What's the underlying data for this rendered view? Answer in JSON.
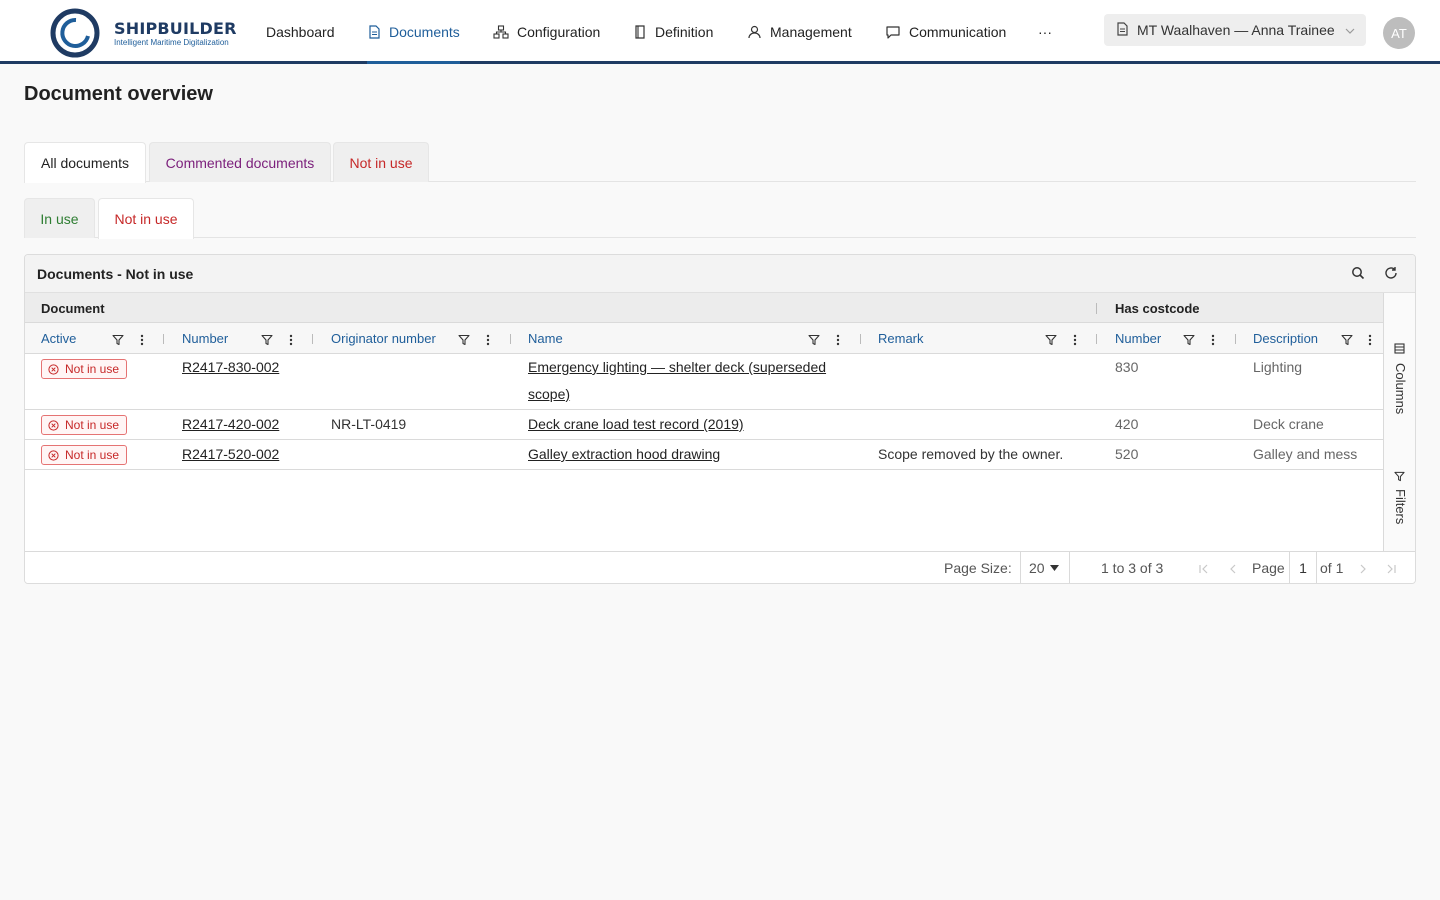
{
  "brand": {
    "name": "SHIPBUILDER",
    "tagline": "Intelligent Maritime Digitalization",
    "color": "#1f3b63"
  },
  "nav": {
    "items": [
      {
        "label": "Dashboard",
        "icon": "none"
      },
      {
        "label": "Documents",
        "icon": "document-icon",
        "active": true
      },
      {
        "label": "Configuration",
        "icon": "hierarchy-icon"
      },
      {
        "label": "Definition",
        "icon": "book-icon"
      },
      {
        "label": "Management",
        "icon": "user-icon"
      },
      {
        "label": "Communication",
        "icon": "chat-icon"
      }
    ],
    "more": "···"
  },
  "vessel": {
    "label": "MT Waalhaven — Anna Trainee"
  },
  "user": {
    "initials": "AT"
  },
  "page": {
    "title": "Document overview"
  },
  "tabs_primary": [
    {
      "label": "All documents",
      "color": "#222222",
      "active": true
    },
    {
      "label": "Commented documents",
      "color": "#7b1f7b"
    },
    {
      "label": "Not in use",
      "color": "#c62828"
    }
  ],
  "tabs_secondary": [
    {
      "label": "In use",
      "color": "#2e7d32"
    },
    {
      "label": "Not in use",
      "color": "#c62828",
      "active": true
    }
  ],
  "grid": {
    "title": "Documents - Not in use",
    "groups": {
      "document": "Document",
      "costcode": "Has costcode"
    },
    "columns": {
      "active": "Active",
      "number": "Number",
      "originator": "Originator number",
      "name": "Name",
      "remark": "Remark",
      "cc_number": "Number",
      "cc_description": "Description"
    },
    "rows": [
      {
        "status": "Not in use",
        "number": "R2417-830-002",
        "originator": "",
        "name_line1": "Emergency lighting — shelter deck (superseded",
        "name_line2": "scope)",
        "remark": "",
        "cc_number": "830",
        "cc_description": "Lighting"
      },
      {
        "status": "Not in use",
        "number": "R2417-420-002",
        "originator": "NR-LT-0419",
        "name_line1": "Deck crane load test record (2019)",
        "name_line2": "",
        "remark": "",
        "cc_number": "420",
        "cc_description": "Deck crane"
      },
      {
        "status": "Not in use",
        "number": "R2417-520-002",
        "originator": "",
        "name_line1": "Galley extraction hood drawing",
        "name_line2": "",
        "remark": "Scope removed by the owner.",
        "cc_number": "520",
        "cc_description": "Galley and mess"
      }
    ],
    "side": {
      "columns": "Columns",
      "filters": "Filters"
    },
    "footer": {
      "page_size_label": "Page Size:",
      "page_size": "20",
      "range": "1 to 3 of 3",
      "page_label": "Page",
      "page": "1",
      "of": "of 1"
    }
  },
  "colors": {
    "accent": "#1f5e9a",
    "danger": "#c62828"
  }
}
